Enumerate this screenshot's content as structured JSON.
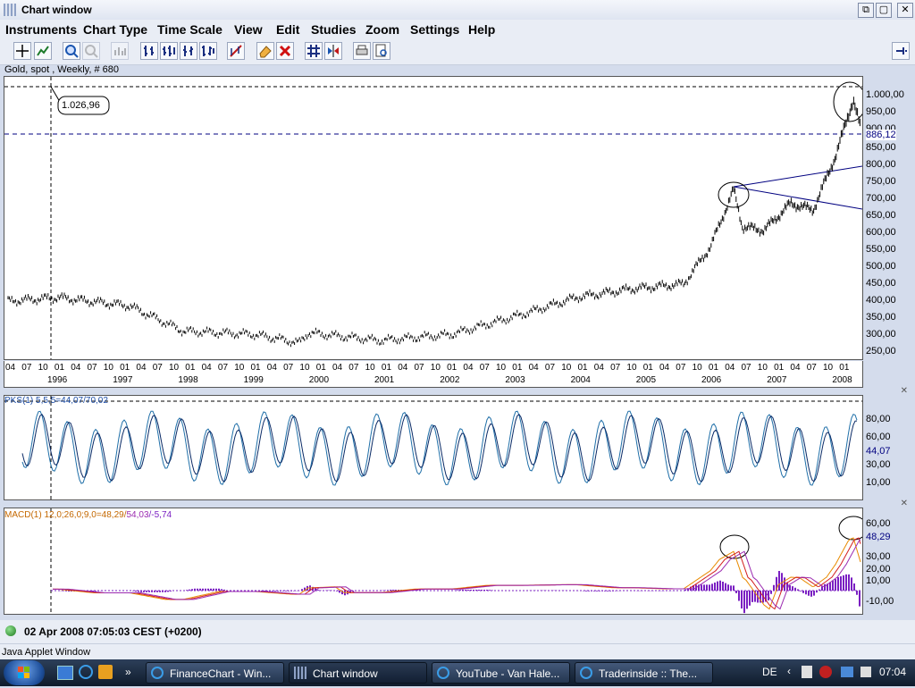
{
  "window": {
    "title": "Chart window"
  },
  "menu": [
    "Instruments",
    "Chart Type",
    "Time Scale",
    "View",
    "Edit",
    "Studies",
    "Zoom",
    "Settings",
    "Help"
  ],
  "instrument_label": "Gold, spot , Weekly, # 680",
  "price_panel": {
    "crosshair_label": "1.026,96",
    "current_label": "886,12",
    "y_ticks": [
      "1.000,00",
      "950,00",
      "900,00",
      "850,00",
      "800,00",
      "750,00",
      "700,00",
      "650,00",
      "600,00",
      "550,00",
      "500,00",
      "450,00",
      "400,00",
      "350,00",
      "300,00",
      "250,00"
    ],
    "x_month_ticks": [
      "04",
      "07",
      "10",
      "01",
      "04",
      "07",
      "10",
      "01",
      "04",
      "07",
      "10",
      "01",
      "04",
      "07",
      "10",
      "01",
      "04",
      "07",
      "10",
      "01",
      "04",
      "07",
      "10",
      "01",
      "04",
      "07",
      "10",
      "01",
      "04",
      "07",
      "10",
      "01",
      "04",
      "07",
      "10",
      "01",
      "04",
      "07",
      "10",
      "01",
      "04",
      "07",
      "10",
      "01",
      "04",
      "07",
      "10",
      "01",
      "04",
      "07",
      "10",
      "01"
    ],
    "x_year_labels": [
      "1996",
      "1997",
      "1998",
      "1999",
      "2000",
      "2001",
      "2002",
      "2003",
      "2004",
      "2005",
      "2006",
      "2007",
      "2008"
    ]
  },
  "pks_panel": {
    "legend": "PKS(1) 5,5,5=44,07/70,02",
    "y_ticks": [
      "80,00",
      "60,00",
      "30,00",
      "10,00"
    ],
    "current_label": "44,07"
  },
  "macd_panel": {
    "legend_prefix": "MACD(1) 12,0;26,0;9,0=48,29/",
    "legend_signal": "54,03",
    "legend_hist": "/-5,74",
    "y_ticks": [
      "60,00",
      "30,00",
      "20,00",
      "10,00",
      "-10,00"
    ],
    "current_label": "48,29"
  },
  "status": {
    "datetime": "02 Apr 2008 07:05:03  CEST (+0200)"
  },
  "applet": {
    "label": "Java Applet Window"
  },
  "taskbar": {
    "tasks": [
      "FinanceChart - Win...",
      "Chart window",
      "YouTube - Van Hale...",
      "Traderinside :: The..."
    ],
    "language": "DE",
    "clock": "07:04"
  },
  "colors": {
    "price_line": "#000000",
    "guide_line": "#000080",
    "pks_fast": "#1f6fa8",
    "pks_slow": "#0a2a66",
    "macd_line": "#e88a00",
    "macd_signal": "#9b2bb0",
    "macd_hist": "#7a1fc2",
    "macd_red": "#d21f1f"
  }
}
